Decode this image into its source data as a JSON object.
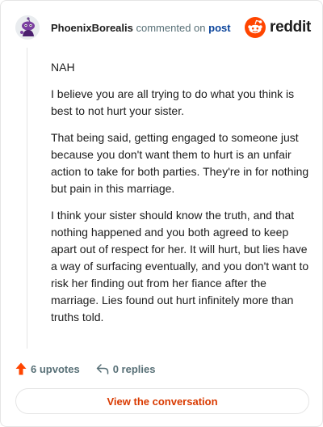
{
  "comment": {
    "author": "PhoenixBorealis",
    "verb": "commented on",
    "target": "post",
    "paragraphs": [
      "NAH",
      "I believe you are all trying to do what you think is best to not hurt your sister.",
      "That being said, getting engaged to someone just because you don't want them to hurt is an unfair action to take for both parties. They're in for nothing but pain in this marriage.",
      "I think your sister should know the truth, and that nothing happened and you both agreed to keep apart out of respect for her. It will hurt, but lies have a way of surfacing eventually, and you don't want to risk her finding out from her fiance after the marriage. Lies found out hurt infinitely more than truths told."
    ]
  },
  "brand": {
    "name": "reddit",
    "icon": "reddit-logo-icon",
    "color": "#ff4500"
  },
  "footer": {
    "upvotes": "6 upvotes",
    "upvote_icon": "upvote-arrow-icon",
    "upvote_color": "#ff4500",
    "replies": "0 replies",
    "reply_icon": "reply-arrow-icon"
  },
  "cta": {
    "label": "View the conversation",
    "color": "#d93a00"
  }
}
